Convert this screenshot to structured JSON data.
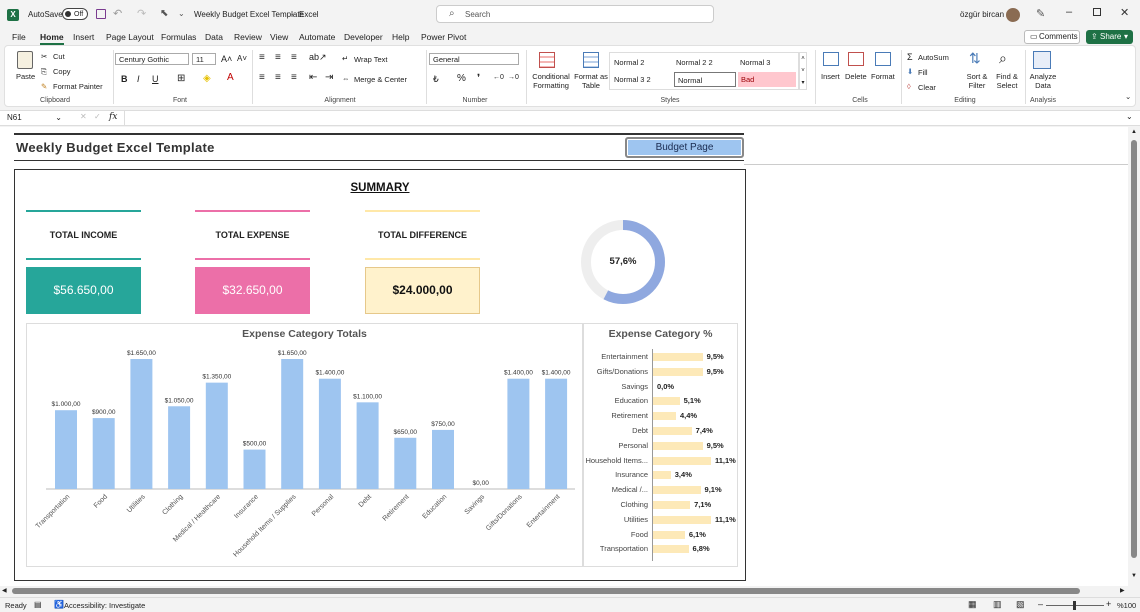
{
  "titlebar": {
    "autosave_label": "AutoSave",
    "autosave_state": "Off",
    "doc_title": "Weekly Budget Excel Template",
    "app_name": "Excel",
    "search_placeholder": "Search",
    "user_name": "özgür bircan"
  },
  "menu": [
    "File",
    "Home",
    "Insert",
    "Page Layout",
    "Formulas",
    "Data",
    "Review",
    "View",
    "Automate",
    "Developer",
    "Help",
    "Power Pivot"
  ],
  "menu_active": "Home",
  "buttons": {
    "comments": "Comments",
    "share": "Share"
  },
  "ribbon": {
    "clipboard": {
      "paste": "Paste",
      "cut": "Cut",
      "copy": "Copy",
      "format_painter": "Format Painter",
      "label": "Clipboard"
    },
    "font": {
      "name": "Century Gothic",
      "size": "11",
      "label": "Font"
    },
    "alignment": {
      "wrap": "Wrap Text",
      "merge": "Merge & Center",
      "label": "Alignment"
    },
    "number": {
      "format": "General",
      "label": "Number"
    },
    "styles": {
      "conditional": "Conditional Formatting",
      "format_table": "Format as Table",
      "cells": [
        "Normal 2",
        "Normal 2 2",
        "Normal 3",
        "Normal 3 2",
        "Normal",
        "Bad"
      ],
      "label": "Styles"
    },
    "cells": {
      "insert": "Insert",
      "delete": "Delete",
      "format": "Format",
      "label": "Cells"
    },
    "editing": {
      "autosum": "AutoSum",
      "fill": "Fill",
      "clear": "Clear",
      "sort": "Sort & Filter",
      "find": "Find & Select",
      "label": "Editing"
    },
    "analysis": {
      "analyze": "Analyze Data",
      "label": "Analysis"
    }
  },
  "formula_bar": {
    "name_box": "N61",
    "fx": "fx",
    "formula": ""
  },
  "sheet": {
    "title": "Weekly Budget Excel Template",
    "budget_button": "Budget Page",
    "summary_title": "SUMMARY",
    "total_income_label": "TOTAL INCOME",
    "total_expense_label": "TOTAL EXPENSE",
    "total_difference_label": "TOTAL DIFFERENCE",
    "total_income_value": "$56.650,00",
    "total_expense_value": "$32.650,00",
    "total_difference_value": "$24.000,00",
    "donut_value": "57,6%",
    "donut_fraction": 0.576
  },
  "colors": {
    "income": "#26a69a",
    "expense": "#ec6fa8",
    "difference_bg": "#fff2cc",
    "bar": "#9ec5f0",
    "donut_fill": "#8fa8df",
    "donut_track": "#eeeeee",
    "pct_bar": "#fde9b8",
    "excel_green": "#1e7145"
  },
  "chart_data": [
    {
      "type": "bar",
      "title": "Expense Category Totals",
      "categories": [
        "Transportation",
        "Food",
        "Utilities",
        "Clothing",
        "Medical / Healthcare",
        "Insurance",
        "Household Items / Supplies",
        "Personal",
        "Debt",
        "Retirement",
        "Education",
        "Savings",
        "Gifts/Donations",
        "Entertainment"
      ],
      "values": [
        1000,
        900,
        1650,
        1050,
        1350,
        500,
        1650,
        1400,
        1100,
        650,
        750,
        0,
        1400,
        1400
      ],
      "data_labels": [
        "$1.000,00",
        "$900,00",
        "$1.650,00",
        "$1.050,00",
        "$1.350,00",
        "$500,00",
        "$1.650,00",
        "$1.400,00",
        "$1.100,00",
        "$650,00",
        "$750,00",
        "$0,00",
        "$1.400,00",
        "$1.400,00"
      ],
      "ylim": [
        0,
        1650
      ]
    },
    {
      "type": "bar",
      "title": "Expense Category %",
      "categories": [
        "Entertainment",
        "Gifts/Donations",
        "Savings",
        "Education",
        "Retirement",
        "Debt",
        "Personal",
        "Household Items...",
        "Insurance",
        "Medical /...",
        "Clothing",
        "Utilities",
        "Food",
        "Transportation"
      ],
      "values": [
        9.5,
        9.5,
        0.0,
        5.1,
        4.4,
        7.4,
        9.5,
        11.1,
        3.4,
        9.1,
        7.1,
        11.1,
        6.1,
        6.8
      ],
      "data_labels": [
        "9,5%",
        "9,5%",
        "0,0%",
        "5,1%",
        "4,4%",
        "7,4%",
        "9,5%",
        "11,1%",
        "3,4%",
        "9,1%",
        "7,1%",
        "11,1%",
        "6,1%",
        "6,8%"
      ],
      "xlim": [
        0,
        11.1
      ]
    }
  ],
  "status": {
    "ready": "Ready",
    "accessibility": "Accessibility: Investigate",
    "zoom": "%100"
  }
}
